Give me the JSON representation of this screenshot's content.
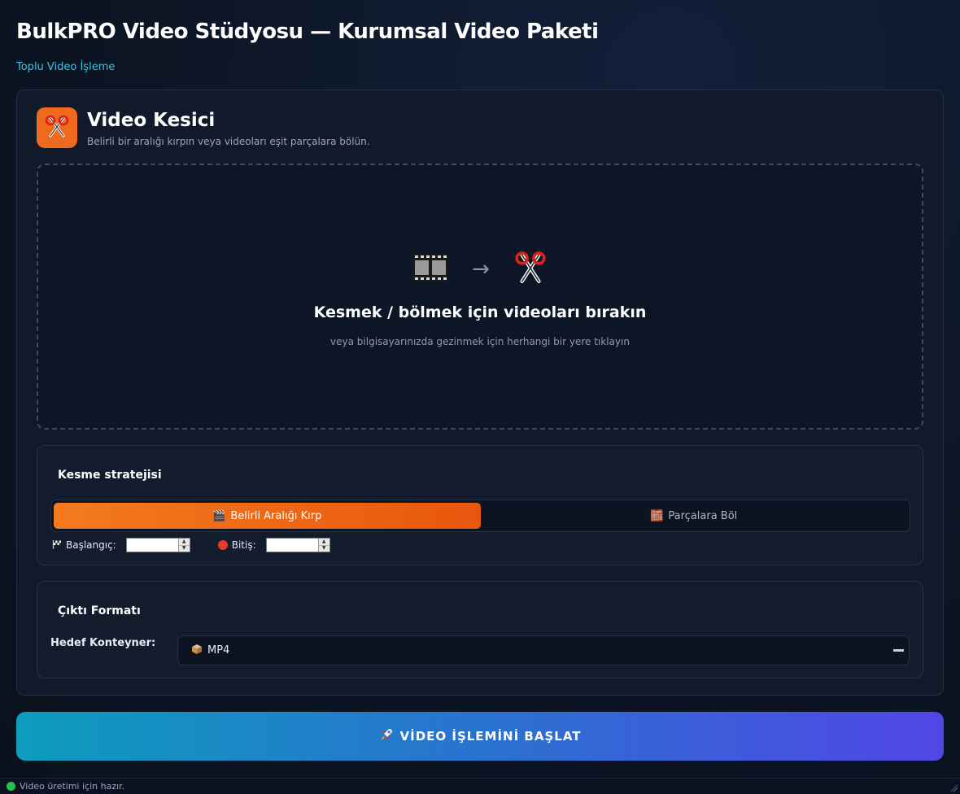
{
  "app": {
    "title": "BulkPRO Video Stüdyosu — Kurumsal Video Paketi",
    "subtitle": "Toplu Video İşleme"
  },
  "tool": {
    "icon": "scissors-icon",
    "title": "Video Kesici",
    "description": "Belirli bir aralığı kırpın veya videoları eşit parçalara bölün."
  },
  "dropzone": {
    "icons": [
      "film-icon",
      "arrow-right-icon",
      "scissors-icon"
    ],
    "arrow": "→",
    "title": "Kesmek / bölmek için videoları bırakın",
    "hint": "veya bilgisayarınızda gezinmek için herhangi bir yere tıklayın"
  },
  "strategy": {
    "title": "Kesme stratejisi",
    "options": [
      {
        "label": "Belirli Aralığı Kırp",
        "icon": "clapper-icon",
        "emoji": "🎬",
        "active": true
      },
      {
        "label": "Parçalara Böl",
        "icon": "bricks-icon",
        "emoji": "🧱",
        "active": false
      }
    ],
    "start_label": "Başlangıç:",
    "start_icon": "flag-icon",
    "start_value": "",
    "end_label": "Bitiş:",
    "end_icon": "red-circle-icon",
    "end_value": ""
  },
  "output": {
    "title": "Çıktı Formatı",
    "container_label": "Hedef Konteyner:",
    "container_value": "MP4",
    "container_icon": "package-icon"
  },
  "action": {
    "start_label": "VİDEO İŞLEMİNİ BAŞLAT",
    "icon": "rocket-icon"
  },
  "status": {
    "text": "Video üretimi için hazır.",
    "color": "#22c34a"
  },
  "colors": {
    "accent_orange": "#f06a1b",
    "accent_cyan": "#38c6e6",
    "gradient_start": "#0d9cbd",
    "gradient_end": "#5146e6"
  }
}
